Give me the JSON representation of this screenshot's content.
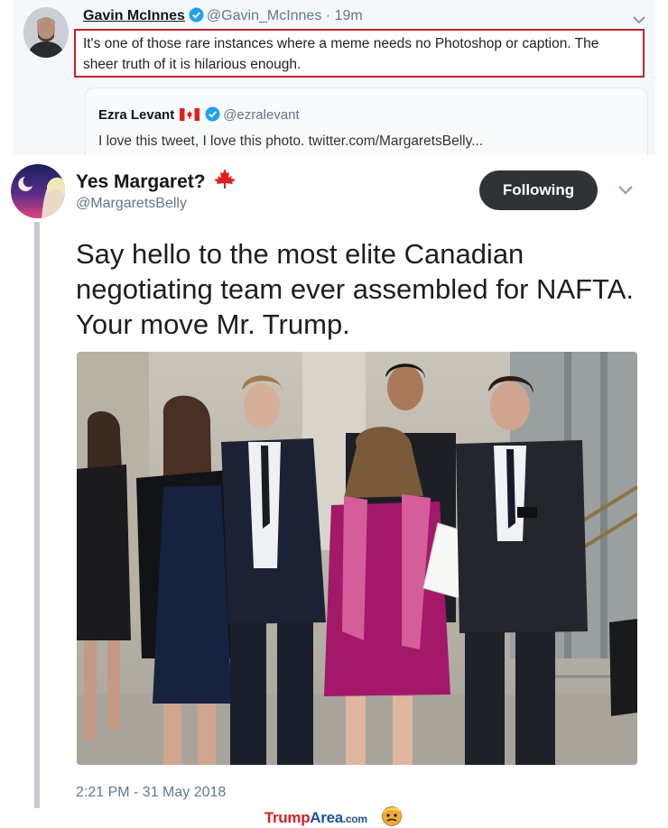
{
  "outer_tweet": {
    "name": "Gavin McInnes",
    "handle": "@Gavin_McInnes",
    "separator": "·",
    "time": "19m",
    "text": "It's one of those rare instances where a meme needs no Photoshop or caption. The sheer truth of it is hilarious enough.",
    "icons": {
      "verified": "verified-badge-icon",
      "menu": "chevron-down-icon"
    }
  },
  "quoted_tweet": {
    "name": "Ezra Levant",
    "handle": "@ezralevant",
    "text": "I love this tweet, I love this photo. twitter.com/MargaretsBelly...",
    "icons": {
      "flag": "canada-flag-icon",
      "verified": "verified-badge-icon"
    }
  },
  "main_tweet": {
    "name": "Yes Margaret?",
    "handle": "@MargaretsBelly",
    "follow_label": "Following",
    "text": "Say hello to the most elite Canadian negotiating team ever assembled for NAFTA. Your move Mr. Trump.",
    "timestamp": "2:21 PM - 31 May 2018",
    "icons": {
      "name_emoji": "maple-leaf-icon",
      "menu": "chevron-down-icon"
    }
  },
  "footer": {
    "brand_a": "Trump",
    "brand_b": "Area",
    "brand_c": ".com"
  },
  "colors": {
    "highlight_border": "#c0242c",
    "follow_button": "#2f3336",
    "verified": "#1da1f2",
    "maple_red": "#e0201f",
    "brand_red": "#d41f26",
    "brand_blue": "#1f4fa0"
  }
}
